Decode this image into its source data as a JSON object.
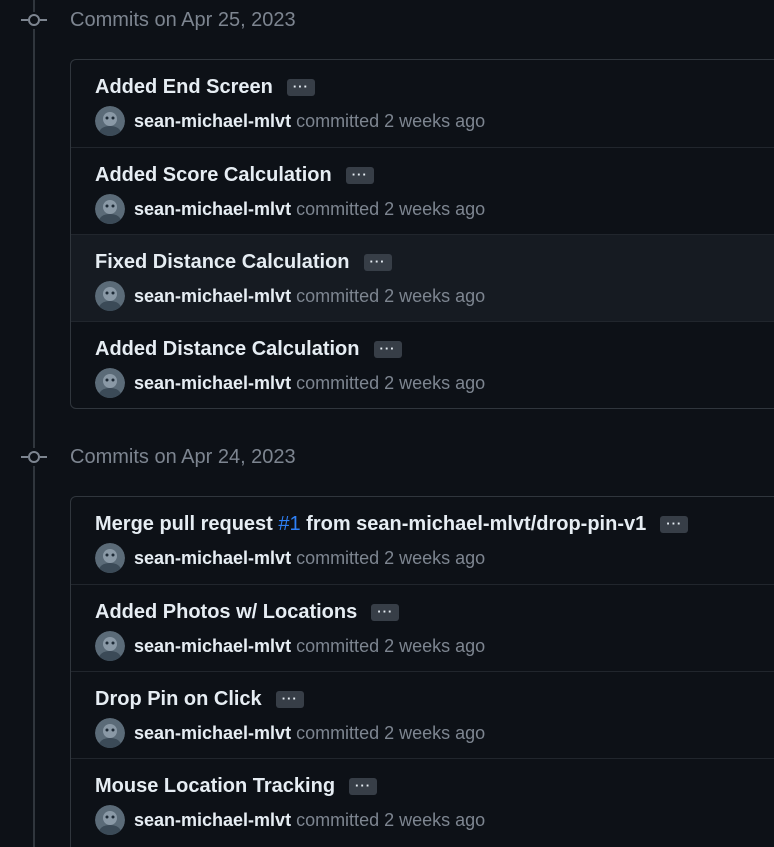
{
  "groups": [
    {
      "title": "Commits on Apr 25, 2023",
      "commits": [
        {
          "title": "Added End Screen",
          "author": "sean-michael-mlvt",
          "verb": "committed",
          "time": "2 weeks ago",
          "more": "···"
        },
        {
          "title": "Added Score Calculation",
          "author": "sean-michael-mlvt",
          "verb": "committed",
          "time": "2 weeks ago",
          "more": "···"
        },
        {
          "title": "Fixed Distance Calculation",
          "author": "sean-michael-mlvt",
          "verb": "committed",
          "time": "2 weeks ago",
          "more": "···",
          "hovered": true
        },
        {
          "title": "Added Distance Calculation",
          "author": "sean-michael-mlvt",
          "verb": "committed",
          "time": "2 weeks ago",
          "more": "···"
        }
      ]
    },
    {
      "title": "Commits on Apr 24, 2023",
      "commits": [
        {
          "title_prefix": "Merge pull request ",
          "pr_link": "#1",
          "title_suffix": " from sean-michael-mlvt/drop-pin-v1",
          "author": "sean-michael-mlvt",
          "verb": "committed",
          "time": "2 weeks ago",
          "more": "···"
        },
        {
          "title": "Added Photos w/ Locations",
          "author": "sean-michael-mlvt",
          "verb": "committed",
          "time": "2 weeks ago",
          "more": "···"
        },
        {
          "title": "Drop Pin on Click",
          "author": "sean-michael-mlvt",
          "verb": "committed",
          "time": "2 weeks ago",
          "more": "···"
        },
        {
          "title": "Mouse Location Tracking",
          "author": "sean-michael-mlvt",
          "verb": "committed",
          "time": "2 weeks ago",
          "more": "···"
        }
      ]
    }
  ],
  "colors": {
    "background": "#0d1117",
    "border": "#30363d",
    "muted_text": "#7d8590",
    "link": "#2f81f7",
    "hover_row": "#161b22"
  },
  "icons": {
    "timeline_node": "git-commit-icon",
    "avatar": "user-avatar"
  }
}
